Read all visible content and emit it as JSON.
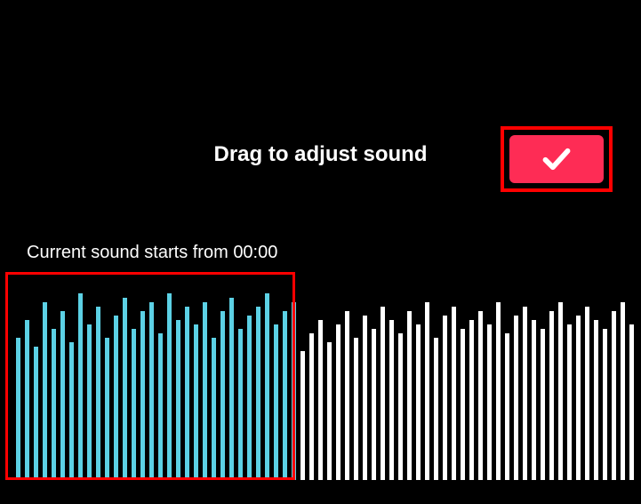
{
  "header": {
    "title": "Drag to adjust sound"
  },
  "confirm": {
    "icon_name": "check-icon"
  },
  "subtitle": {
    "prefix": "Current sound starts from ",
    "time": "00:00"
  },
  "waveform": {
    "selected_count": 32,
    "bars": [
      160,
      180,
      150,
      200,
      170,
      190,
      155,
      210,
      175,
      195,
      160,
      185,
      205,
      170,
      190,
      200,
      165,
      210,
      180,
      195,
      175,
      200,
      160,
      190,
      205,
      170,
      185,
      195,
      210,
      175,
      190,
      200,
      145,
      165,
      180,
      155,
      175,
      190,
      160,
      185,
      170,
      195,
      180,
      165,
      190,
      175,
      200,
      160,
      185,
      195,
      170,
      180,
      190,
      175,
      200,
      165,
      185,
      195,
      180,
      170,
      190,
      200,
      175,
      185,
      195,
      180,
      170,
      190,
      200,
      175
    ]
  }
}
